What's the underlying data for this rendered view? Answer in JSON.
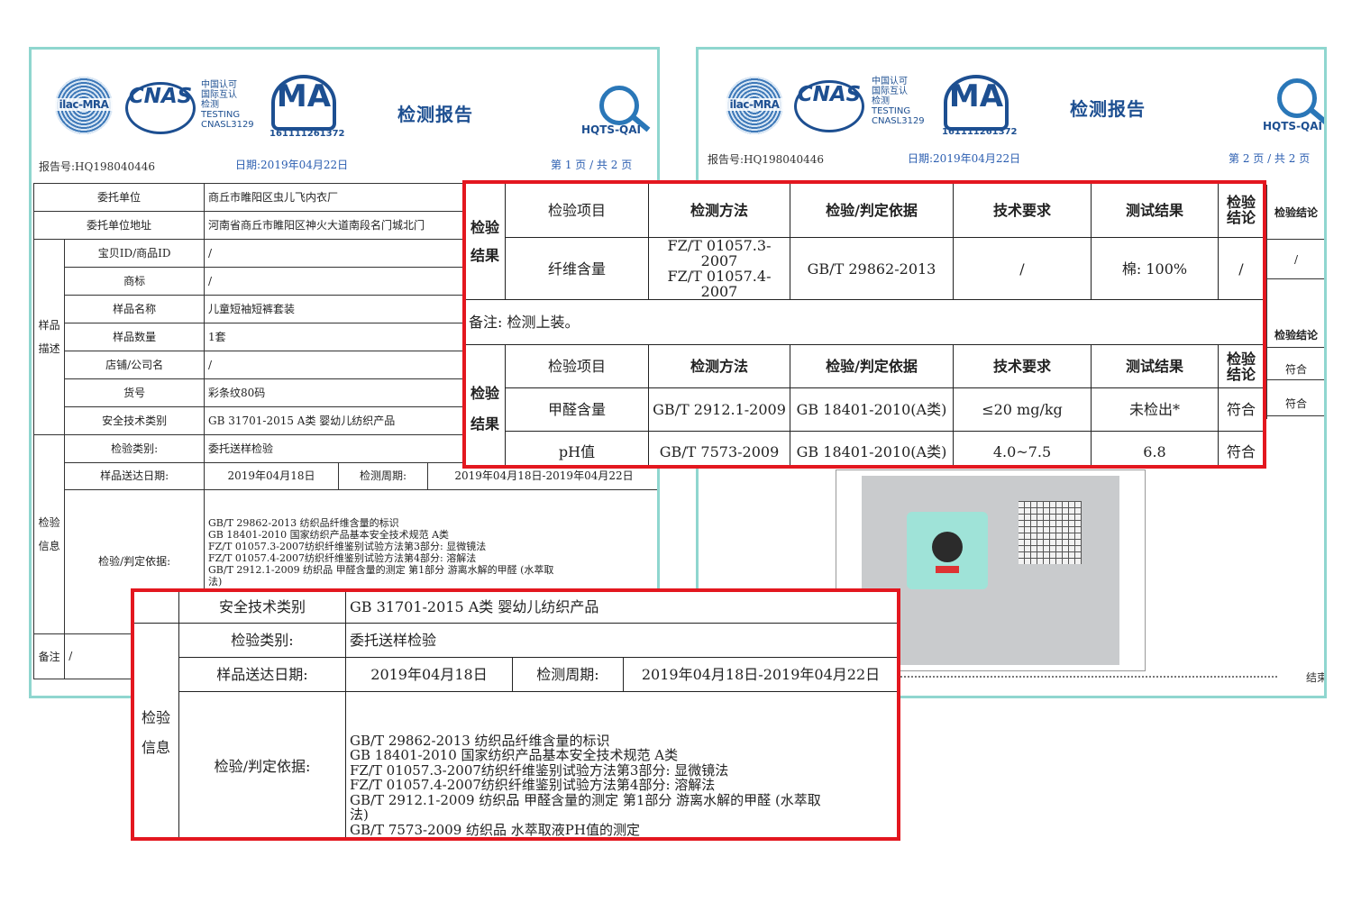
{
  "report": {
    "logos": {
      "ilac": "ilac-MRA",
      "cnas": "CNAS",
      "cnas_side": "中国认可\n国际互认\n检测\nTESTING\nCNASL3129",
      "ma": "MA",
      "ma_number": "161111261372",
      "hqts": "HQTS-QAI"
    },
    "title": "检测报告",
    "report_no": "报告号:HQ198040446",
    "date": "日期:2019年04月22日",
    "page1": "第 1 页 / 共 2 页",
    "page2": "第 2 页 / 共 2 页"
  },
  "page1_table": {
    "client": {
      "label": "委托单位",
      "value": "商丘市睢阳区虫儿飞内衣厂"
    },
    "client_address": {
      "label": "委托单位地址",
      "value": "河南省商丘市睢阳区神火大道南段名门城北门"
    },
    "sample_group": "样品描述",
    "sample_rows": [
      {
        "label": "宝贝ID/商品ID",
        "value": "/"
      },
      {
        "label": "商标",
        "value": "/"
      },
      {
        "label": "样品名称",
        "value": "儿童短袖短裤套装"
      },
      {
        "label": "样品数量",
        "value": "1套"
      },
      {
        "label": "店铺/公司名",
        "value": "/"
      },
      {
        "label": "货号",
        "value": "彩条纹80码"
      },
      {
        "label": "安全技术类别",
        "value": "GB 31701-2015 A类 婴幼儿纺织产品"
      }
    ],
    "inspection_group": "检验信息",
    "inspection_type": {
      "label": "检验类别:",
      "value": "委托送样检验"
    },
    "delivery": {
      "label": "样品送达日期:",
      "value": "2019年04月18日",
      "period_label": "检测周期:",
      "period_value": "2019年04月18日-2019年04月22日"
    },
    "basis_label": "检验/判定依据:",
    "basis_lines": [
      "GB/T 29862-2013  纺织品纤维含量的标识",
      "GB 18401-2010  国家纺织产品基本安全技术规范  A类",
      "FZ/T 01057.3-2007纺织纤维鉴别试验方法第3部分: 显微镜法",
      "FZ/T 01057.4-2007纺织纤维鉴别试验方法第4部分: 溶解法",
      "GB/T 2912.1-2009 纺织品  甲醛含量的测定  第1部分  游离水解的甲醛 (水萃取",
      "法)"
    ],
    "remark_label": "备注",
    "remark_value": "/"
  },
  "page2_peek": {
    "conclusion": "检验结论",
    "slash": "/",
    "pass": "符合",
    "end": "结束"
  },
  "zoom_results": {
    "group_label": "检验结果",
    "headers": [
      "检验项目",
      "检测方法",
      "检验/判定依据",
      "技术要求",
      "测试结果",
      "检验结论"
    ],
    "fiber_row": {
      "item": "纤维含量",
      "method1": "FZ/T 01057.3-2007",
      "method2": "FZ/T 01057.4-2007",
      "basis": "GB/T 29862-2013",
      "req": "/",
      "result": "棉: 100%",
      "conclusion": "/"
    },
    "remark": "备注: 检测上装。",
    "rows": [
      {
        "item": "甲醛含量",
        "method": "GB/T 2912.1-2009",
        "basis": "GB 18401-2010(A类)",
        "req": "≤20 mg/kg",
        "result": "未检出*",
        "conclusion": "符合"
      },
      {
        "item": "pH值",
        "method": "GB/T 7573-2009",
        "basis": "GB 18401-2010(A类)",
        "req": "4.0~7.5",
        "result": "6.8",
        "conclusion": "符合"
      }
    ]
  },
  "zoom_info": {
    "safety": {
      "label": "安全技术类别",
      "value": "GB 31701-2015 A类 婴幼儿纺织产品"
    },
    "group_label": "检验信息",
    "inspection_type": {
      "label": "检验类别:",
      "value": "委托送样检验"
    },
    "delivery": {
      "label": "样品送达日期:",
      "value": "2019年04月18日",
      "period_label": "检测周期:",
      "period_value": "2019年04月18日-2019年04月22日"
    },
    "basis_label": "检验/判定依据:",
    "basis_lines": [
      "GB/T 29862-2013  纺织品纤维含量的标识",
      "GB 18401-2010  国家纺织产品基本安全技术规范  A类",
      "FZ/T 01057.3-2007纺织纤维鉴别试验方法第3部分: 显微镜法",
      "FZ/T 01057.4-2007纺织纤维鉴别试验方法第4部分: 溶解法",
      "GB/T 2912.1-2009 纺织品  甲醛含量的测定  第1部分  游离水解的甲醛 (水萃取",
      "法)",
      "GB/T 7573-2009 纺织品  水萃取液PH值的测定"
    ]
  },
  "colors": {
    "frame": "#8fd6cf",
    "highlight": "#e3171f",
    "logo_blue": "#1d4f91"
  }
}
